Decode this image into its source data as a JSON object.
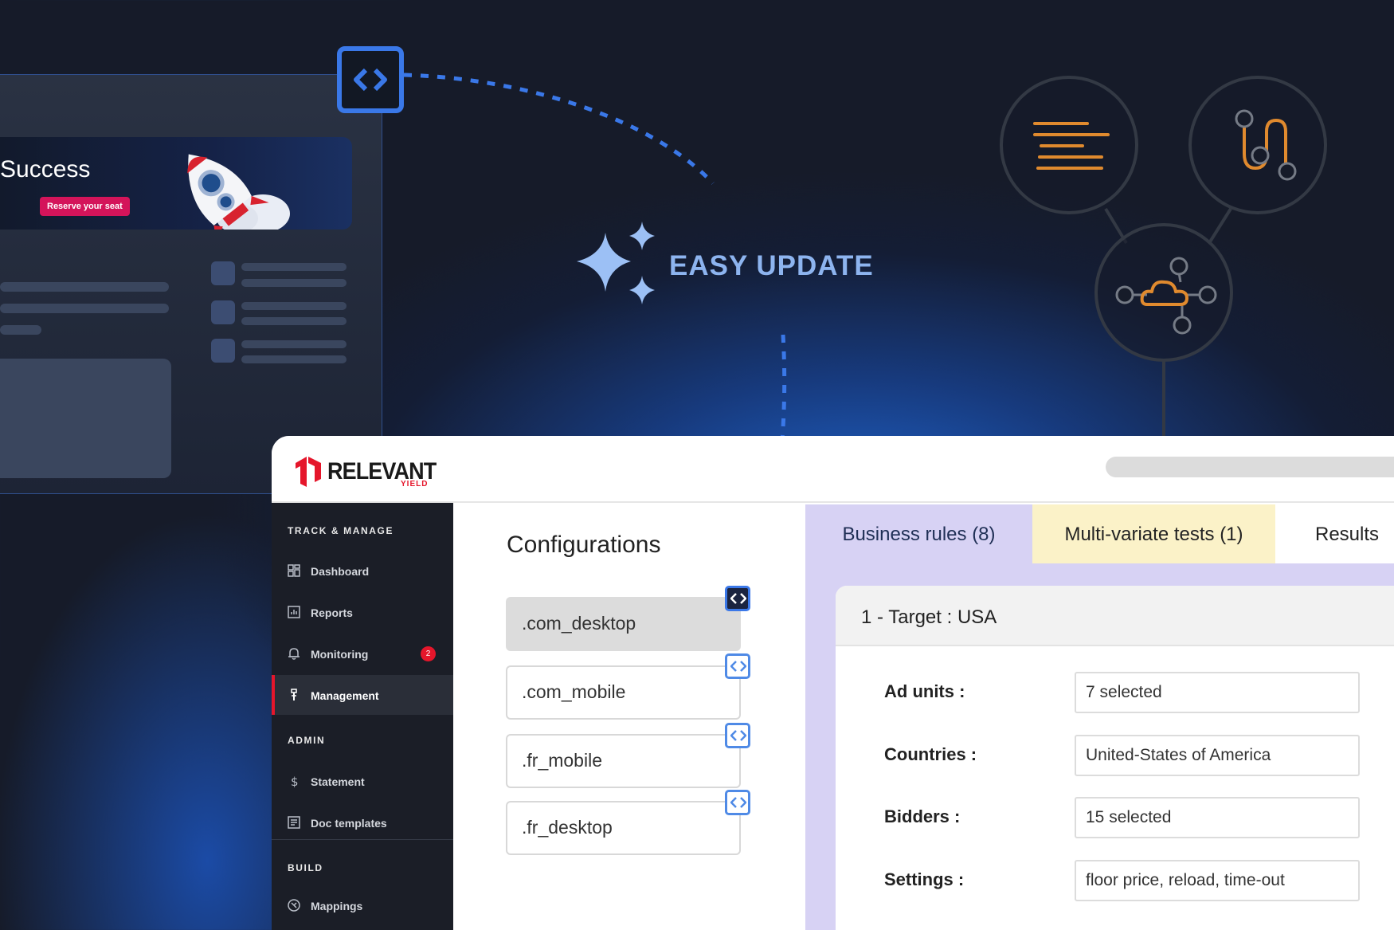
{
  "promo": {
    "title": "Success",
    "button_label": "Reserve your seat"
  },
  "headline": "EASY UPDATE",
  "brand": {
    "name": "RELEVANT",
    "sub": "YIELD",
    "color": "#e5162b"
  },
  "sidebar": {
    "sections": [
      {
        "label": "TRACK & MANAGE"
      },
      {
        "label": "ADMIN"
      },
      {
        "label": "BUILD"
      }
    ],
    "items": [
      {
        "label": "Dashboard",
        "icon": "dashboard-icon"
      },
      {
        "label": "Reports",
        "icon": "reports-icon"
      },
      {
        "label": "Monitoring",
        "icon": "bell-icon",
        "badge": "2"
      },
      {
        "label": "Management",
        "icon": "management-icon",
        "active": true
      },
      {
        "label": "Statement",
        "icon": "dollar-icon"
      },
      {
        "label": "Doc templates",
        "icon": "document-icon"
      },
      {
        "label": "Mappings",
        "icon": "mappings-icon"
      }
    ]
  },
  "configurations": {
    "title": "Configurations",
    "items": [
      {
        "label": ".com_desktop",
        "selected": true
      },
      {
        "label": ".com_mobile"
      },
      {
        "label": ".fr_mobile"
      },
      {
        "label": ".fr_desktop"
      }
    ]
  },
  "tabs": [
    {
      "label": "Business rules (8)",
      "active": true
    },
    {
      "label": "Multi-variate tests (1)"
    },
    {
      "label": "Results"
    }
  ],
  "rule": {
    "title": "1 - Target : USA",
    "fields": [
      {
        "label": "Ad units :",
        "value": "7 selected"
      },
      {
        "label": "Countries :",
        "value": "United-States of America"
      },
      {
        "label": "Bidders :",
        "value": "15 selected"
      },
      {
        "label": "Settings :",
        "value": "floor price, reload, time-out"
      }
    ]
  },
  "colors": {
    "accent_blue": "#3a78e8",
    "tab_purple": "#d7d2f4",
    "tab_yellow": "#fbf2c8",
    "icon_orange": "#e08a2e"
  }
}
